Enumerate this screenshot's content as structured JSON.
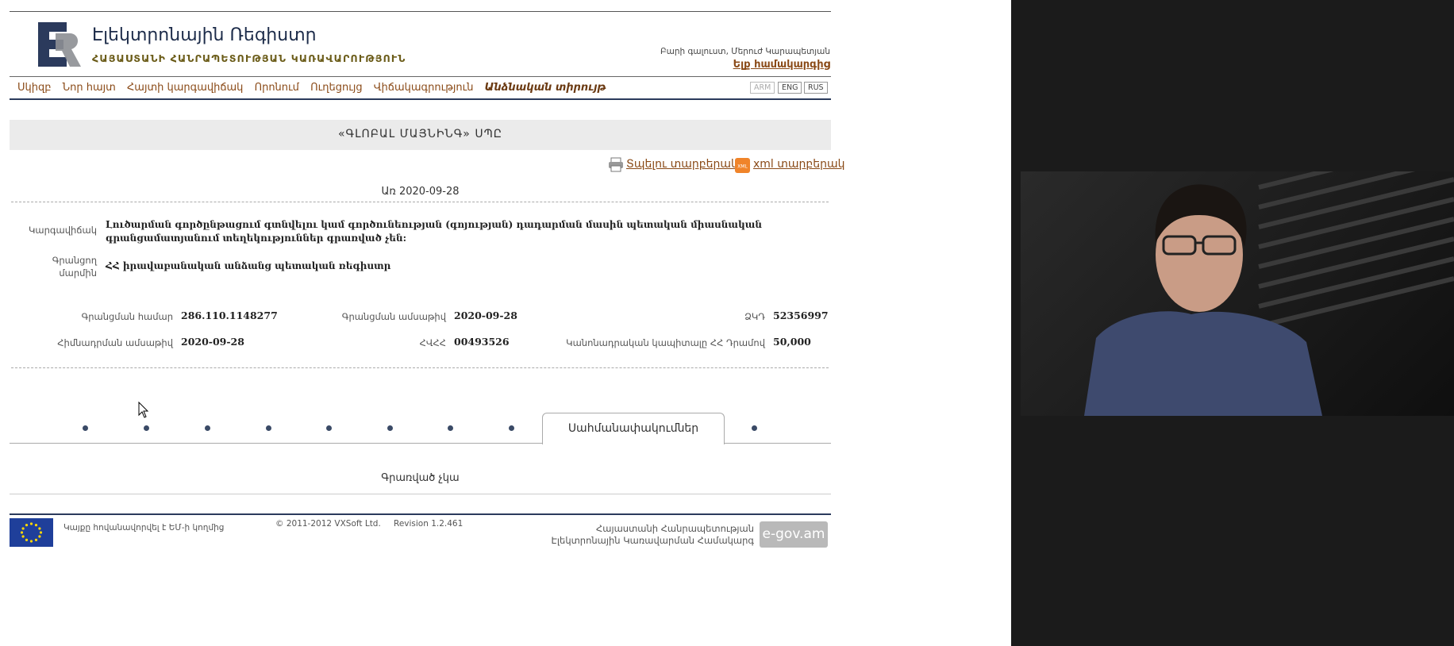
{
  "header": {
    "title": "Էլեկտրոնային Ռեգիստր",
    "subtitle": "ՀԱՅԱՍՏԱՆԻ ՀԱՆՐԱՊԵՏՈՒԹՅԱՆ ԿԱՌԱՎԱՐՈՒԹՅՈՒՆ",
    "welcome": "Բարի գալուստ, Մերուժ Կարապետյան",
    "logout": "Ելք համակարգից"
  },
  "nav": {
    "items": [
      "Սկիզբ",
      "Նոր հայտ",
      "Հայտի կարգավիճակ",
      "Որոնում",
      "Ուղեցույց",
      "Վիճակագրություն",
      "Անձնական տիրույթ"
    ],
    "languages": [
      "ARM",
      "ENG",
      "RUS"
    ]
  },
  "company": {
    "name": "«ԳԼՈԲԱԼ ՄԱՅՆԻՆԳ» ՍՊԸ",
    "print_link": "Տպելու տարբերակ",
    "xml_link": "xml տարբերակ",
    "as_of": "Առ 2020-09-28",
    "status_label": "Կարգավիճակ",
    "status_value": "Լուծարման գործընթացում գտնվելու կամ գործունեության (գոյության) դադարման մասին պետական միասնական գրանցամատյանում տեղեկություններ գրառված չեն:",
    "registrar_label": "Գրանցող մարմին",
    "registrar_value": "ՀՀ իրավաբանական անձանց պետական ռեգիստր",
    "reg_number_label": "Գրանցման համար",
    "reg_number_value": "286.110.1148277",
    "reg_date_label": "Գրանցման ամսաթիվ",
    "reg_date_value": "2020-09-28",
    "tin_label": "ՀՎՀՀ",
    "tin_value": "00493526",
    "zkd_label": "ՁԿԴ",
    "zkd_value": "52356997",
    "found_date_label": "Հիմնադրման ամսաթիվ",
    "found_date_value": "2020-09-28",
    "capital_label": "Կանոնադրական կապիտալը ՀՀ Դրամով",
    "capital_value": "50,000"
  },
  "tabs": {
    "active": "Սահմանափակումներ",
    "content": "Գրառված չկա"
  },
  "footer": {
    "eu_text": "Կայքը հովանավորվել է ԵՄ-ի կողմից",
    "copyright": "© 2011-2012 VXSoft Ltd.",
    "revision": "Revision 1.2.461",
    "gov_line1": "Հայաստանի Հանրապետության",
    "gov_line2": "Էլեկտրոնային Կառավարման Համակարգ",
    "egov": "e-gov.am"
  },
  "colors": {
    "brand_navy": "#1d2c4a",
    "link_brown": "#8a4a17",
    "band_gray": "#ebebeb"
  }
}
